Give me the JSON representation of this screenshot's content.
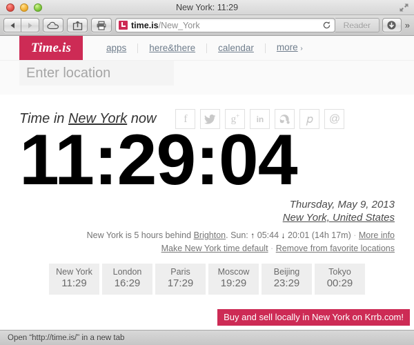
{
  "window": {
    "title": "New York: 11:29",
    "traffic_lights": [
      "close",
      "minimize",
      "zoom"
    ],
    "fullscreen_icon": "fullscreen-arrows-icon"
  },
  "toolbar": {
    "back_icon": "back-arrow-icon",
    "forward_icon": "forward-arrow-icon",
    "icloud_icon": "icloud-tabs-icon",
    "share_icon": "share-icon",
    "print_icon": "print-icon",
    "url_domain": "time.is",
    "url_path": "/New_York",
    "reload_icon": "reload-icon",
    "reader_label": "Reader",
    "downloads_icon": "downloads-icon",
    "overflow_label": "»"
  },
  "site": {
    "logo": "Time.is",
    "nav": [
      {
        "label": "apps"
      },
      {
        "label": "here&there"
      },
      {
        "label": "calendar"
      },
      {
        "label": "more",
        "caret": "›"
      }
    ],
    "search": {
      "value": "",
      "placeholder": "Enter location"
    }
  },
  "main": {
    "heading_prefix": "Time in ",
    "heading_location": "New York",
    "heading_suffix": " now",
    "social": [
      {
        "name": "facebook-icon",
        "glyph": "f"
      },
      {
        "name": "twitter-icon",
        "glyph": "🐦"
      },
      {
        "name": "googleplus-icon",
        "glyph": "g+"
      },
      {
        "name": "linkedin-icon",
        "glyph": "in"
      },
      {
        "name": "stumbleupon-icon",
        "glyph": "su"
      },
      {
        "name": "pinterest-icon",
        "glyph": "𝑝"
      },
      {
        "name": "email-icon",
        "glyph": "@"
      }
    ],
    "clock": "11:29:04",
    "date": "Thursday, May 9, 2013",
    "location": "New York, United States",
    "offset_text_pre": "New York is 5 hours behind ",
    "offset_reference": "Brighton",
    "offset_text_post": ". Sun: ",
    "sunrise_arrow": "↑",
    "sunrise": "05:44",
    "sunset_arrow": "↓",
    "sunset": "20:01",
    "daylength": "(14h 17m)",
    "more_info": "More info",
    "make_default": "Make New York time default",
    "remove_favorite": "Remove from favorite locations",
    "separator": "·"
  },
  "cities": [
    {
      "name": "New York",
      "time": "11:29"
    },
    {
      "name": "London",
      "time": "16:29"
    },
    {
      "name": "Paris",
      "time": "17:29"
    },
    {
      "name": "Moscow",
      "time": "19:29"
    },
    {
      "name": "Beijing",
      "time": "23:29"
    },
    {
      "name": "Tokyo",
      "time": "00:29"
    }
  ],
  "ad": {
    "text": "Buy and sell locally in New York on Krrb.com!"
  },
  "statusbar": {
    "text": "Open “http://time.is/” in a new tab"
  },
  "colors": {
    "brand": "#cd2b55",
    "city_tile": "#eeeeee",
    "link": "#6f7d8c"
  }
}
